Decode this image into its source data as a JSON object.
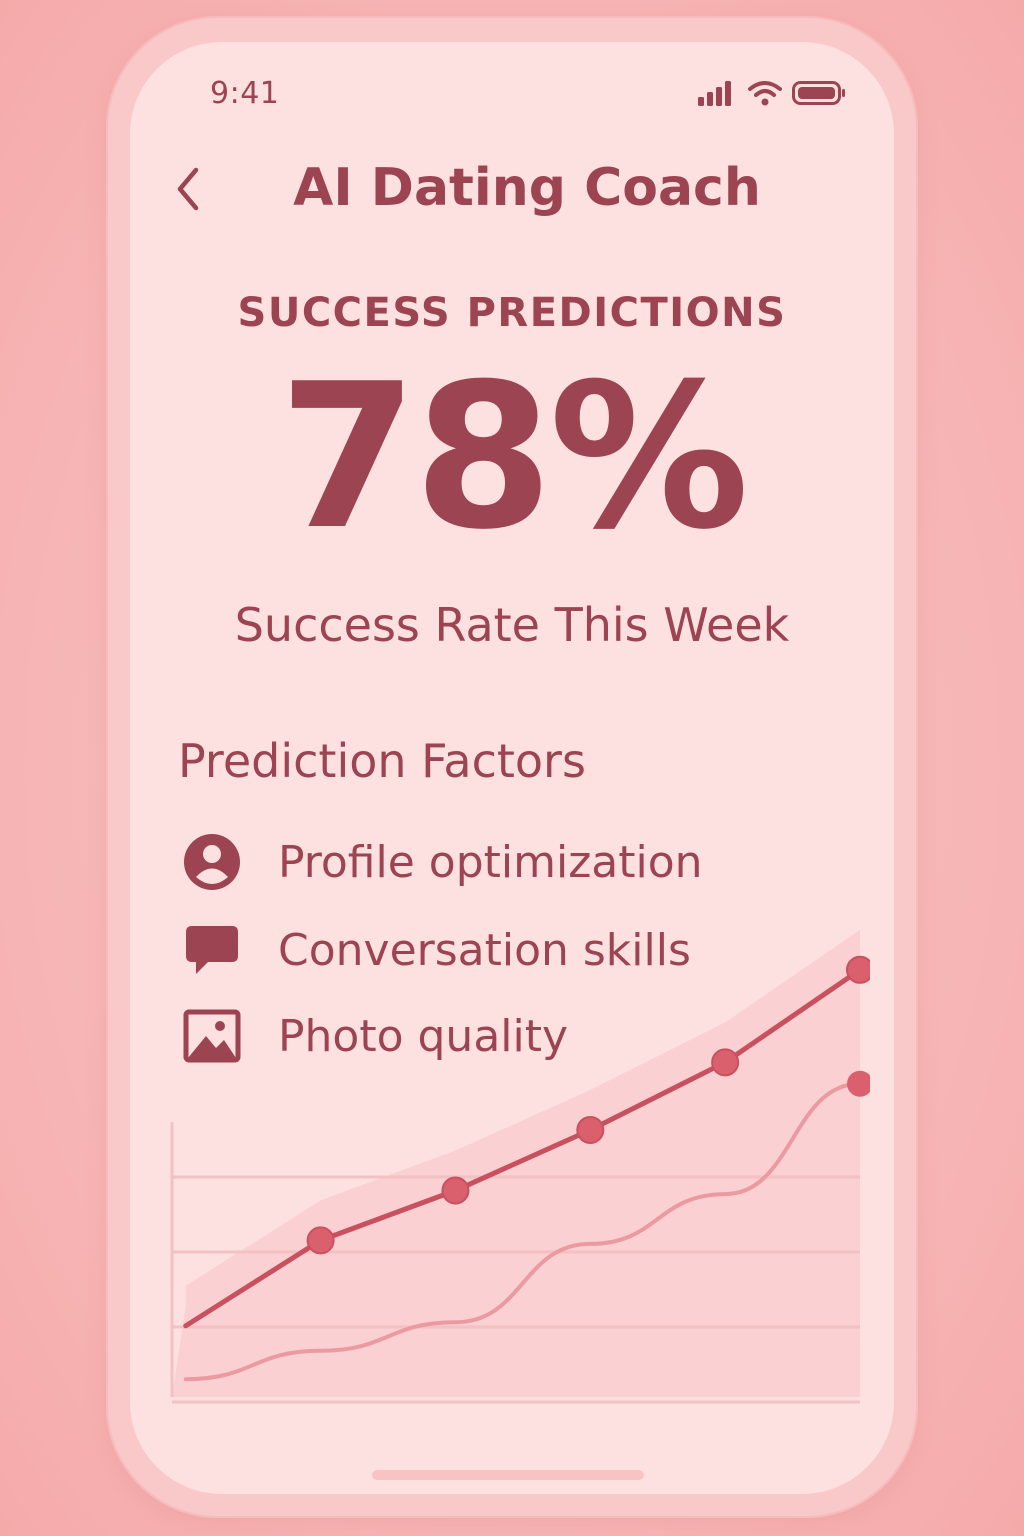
{
  "status_bar": {
    "time": "9:41",
    "icons": [
      "signal-icon",
      "wifi-icon",
      "battery-icon"
    ]
  },
  "header": {
    "back_icon": "chevron-left-icon",
    "title": "AI Dating Coach"
  },
  "prediction": {
    "section_label": "SUCCESS PREDICTIONS",
    "value": "78%",
    "caption": "Success Rate This Week"
  },
  "factors": {
    "title": "Prediction Factors",
    "items": [
      {
        "icon": "user-icon",
        "label": "Profile optimization"
      },
      {
        "icon": "chat-bubble-icon",
        "label": "Conversation skills"
      },
      {
        "icon": "image-icon",
        "label": "Photo quality"
      }
    ]
  },
  "colors": {
    "background": "#f8b9b9",
    "screen": "#fde1e1",
    "text": "#9c4452",
    "accent": "#d9606c",
    "line_light": "#eb9aa2"
  },
  "chart_data": {
    "type": "line",
    "series": [
      {
        "values": [
          0,
          24,
          38,
          55,
          74,
          100
        ],
        "markers": true
      },
      {
        "values": [
          -15,
          -7,
          1,
          23,
          37,
          68
        ],
        "markers": false
      }
    ],
    "grid": true
  }
}
